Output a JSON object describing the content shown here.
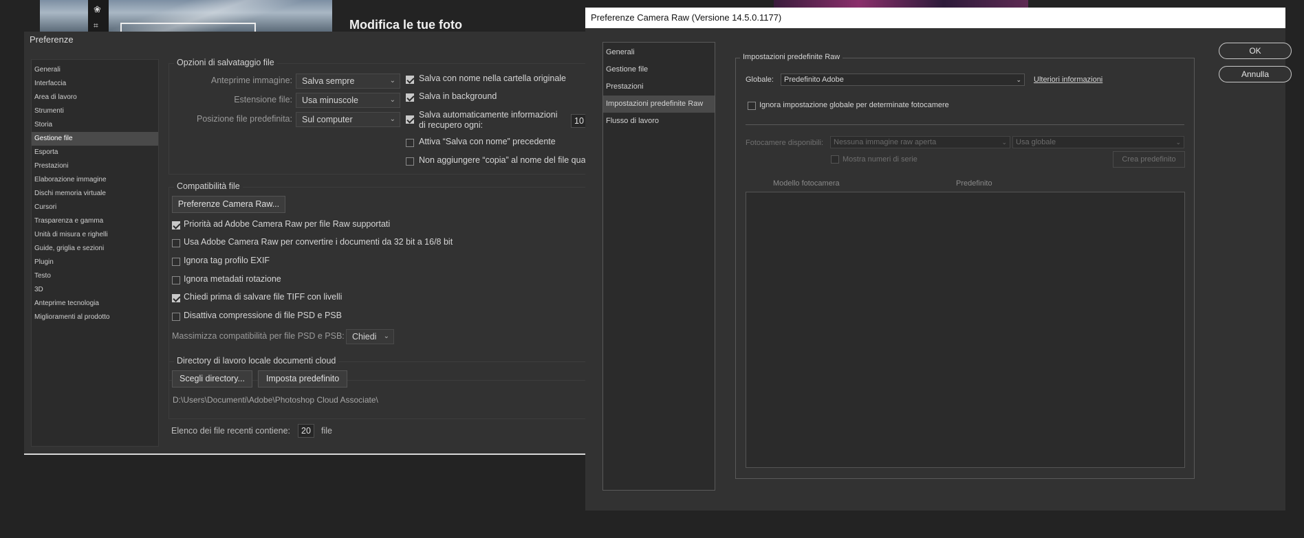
{
  "background": {
    "headline": "Modifica le tue foto"
  },
  "pref": {
    "title": "Preferenze",
    "sidebar": [
      "Generali",
      "Interfaccia",
      "Area di lavoro",
      "Strumenti",
      "Storia",
      "Gestione file",
      "Esporta",
      "Prestazioni",
      "Elaborazione immagine",
      "Dischi memoria virtuale",
      "Cursori",
      "Trasparenza e gamma",
      "Unità di misura e righelli",
      "Guide, griglia e sezioni",
      "Plugin",
      "Testo",
      "3D",
      "Anteprime tecnologia",
      "Miglioramenti al prodotto"
    ],
    "selected_index": 5,
    "save": {
      "title": "Opzioni di salvataggio file",
      "preview_label": "Anteprime immagine:",
      "preview_value": "Salva sempre",
      "ext_label": "Estensione file:",
      "ext_value": "Usa minuscole",
      "pos_label": "Posizione file predefinita:",
      "pos_value": "Sul computer",
      "cb_save_original": "Salva con nome nella cartella originale",
      "cb_background": "Salva in background",
      "cb_auto_line1": "Salva automaticamente informazioni",
      "cb_auto_line2": "di recupero ogni:",
      "auto_value": "10",
      "cb_save_as": "Attiva “Salva con nome” precedente",
      "cb_copy": "Non aggiungere “copia” al nome del file qua"
    },
    "compat": {
      "title": "Compatibilità file",
      "camera_raw_button": "Preferenze Camera Raw...",
      "cb1": "Priorità ad Adobe Camera Raw per file Raw supportati",
      "cb2": "Usa Adobe Camera Raw per convertire i documenti da 32 bit a 16/8 bit",
      "cb3": "Ignora tag profilo EXIF",
      "cb4": "Ignora metadati rotazione",
      "cb5": "Chiedi prima di salvare file TIFF con livelli",
      "cb6": "Disattiva compressione di file PSD e PSB",
      "max_label": "Massimizza compatibilità per file PSD e PSB:",
      "max_value": "Chiedi"
    },
    "cloud": {
      "title": "Directory di lavoro locale documenti cloud",
      "choose_button": "Scegli directory...",
      "default_button": "Imposta predefinito",
      "path": "D:\\Users\\Documenti\\Adobe\\Photoshop Cloud Associate\\"
    },
    "recent": {
      "label": "Elenco dei file recenti contiene:",
      "value": "20",
      "unit": "file"
    }
  },
  "camera_raw": {
    "title": "Preferenze Camera Raw  (Versione 14.5.0.1177)",
    "sidebar": [
      "Generali",
      "Gestione file",
      "Prestazioni",
      "Impostazioni predefinite Raw",
      "Flusso di lavoro"
    ],
    "selected_index": 3,
    "group_title": "Impostazioni predefinite Raw",
    "global_label": "Globale:",
    "global_value": "Predefinito Adobe",
    "more_info": "Ulteriori informazioni",
    "ignore_global": "Ignora impostazione globale per determinate fotocamere",
    "cameras_label": "Fotocamere disponibili:",
    "cameras_value": "Nessuna immagine raw aperta",
    "use_global": "Usa globale",
    "show_serial": "Mostra numeri di serie",
    "create_default": "Crea predefinito",
    "col_model": "Modello fotocamera",
    "col_default": "Predefinito",
    "ok": "OK",
    "cancel": "Annulla"
  }
}
